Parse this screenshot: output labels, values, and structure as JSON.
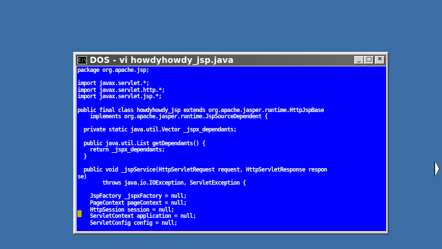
{
  "window": {
    "title": "DOS - vi howdyhowdy_jsp.java",
    "icon_text": "C:\\",
    "controls": {
      "minimize": "_",
      "maximize": "□",
      "close": "✕"
    }
  },
  "terminal": {
    "background": "#0000ff",
    "foreground": "#ffffff",
    "cursor_color": "#c8b400",
    "lines": [
      "package org.apache.jsp;",
      "",
      "import javax.servlet.*;",
      "import javax.servlet.http.*;",
      "import javax.servlet.jsp.*;",
      "",
      "public final class howdyhowdy_jsp extends org.apache.jasper.runtime.HttpJspBase",
      "    implements org.apache.jasper.runtime.JspSourceDependent {",
      "",
      "  private static java.util.Vector _jspx_dependants;",
      "",
      "  public java.util.List getDependants() {",
      "    return _jspx_dependants;",
      "  }",
      "",
      "  public void _jspService(HttpServletRequest request, HttpServletResponse respon",
      "se)",
      "        throws java.io.IOException, ServletException {",
      "",
      "    JspFactory _jspxFactory = null;",
      "    PageContext pageContext = null;",
      "    HttpSession session = null;",
      "    ServletContext application = null;",
      "    ServletConfig config = null;"
    ]
  }
}
